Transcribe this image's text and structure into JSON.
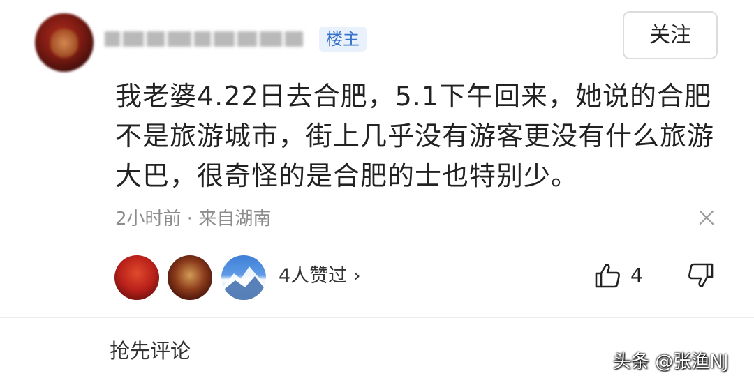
{
  "header": {
    "op_badge": "楼主",
    "follow_label": "关注"
  },
  "comment": {
    "text": "我老婆4.22日去合肥，5.1下午回来，她说的合肥不是旅游城市，街上几乎没有游客更没有什么旅游大巴，很奇怪的是合肥的士也特别少。",
    "meta": "2小时前 · 来自湖南"
  },
  "likes": {
    "summary": "4人赞过 ›",
    "count": "4"
  },
  "footer": {
    "comment_placeholder": "抢先评论"
  },
  "watermark": "头条 @张渔NJ",
  "colors": {
    "badge_bg": "#e9f1fc",
    "badge_text": "#3873c7",
    "meta_text": "#8c8c8c"
  }
}
